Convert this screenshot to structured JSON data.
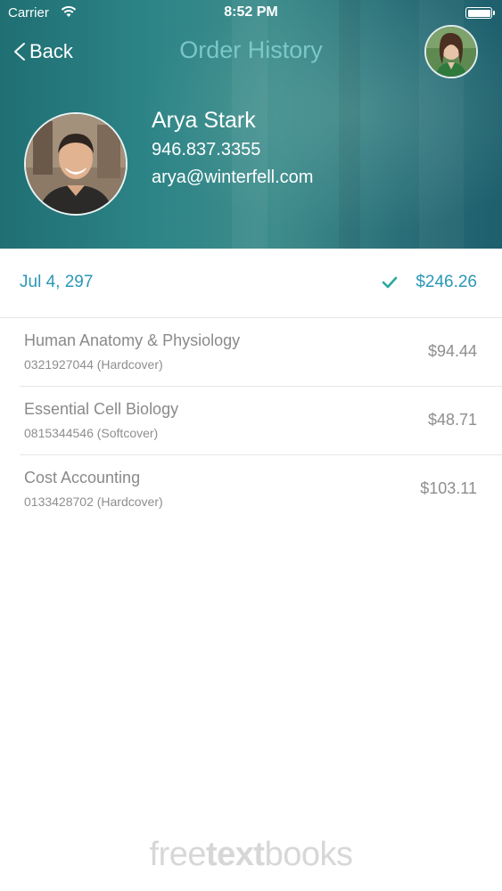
{
  "status_bar": {
    "carrier": "Carrier",
    "time": "8:52 PM",
    "wifi_icon": "wifi-icon",
    "battery_icon": "battery-icon"
  },
  "nav": {
    "back_label": "Back",
    "back_icon": "chevron-left-icon",
    "title": "Order History",
    "avatar": "user-avatar"
  },
  "profile": {
    "name": "Arya Stark",
    "phone": "946.837.3355",
    "email": "arya@winterfell.com"
  },
  "order": {
    "date": "Jul 4, 297",
    "status_icon": "checkmark-icon",
    "total": "$246.26"
  },
  "items": [
    {
      "title": "Human Anatomy & Physiology",
      "subtitle": "0321927044 (Hardcover)",
      "price": "$94.44"
    },
    {
      "title": "Essential Cell Biology",
      "subtitle": "0815344546 (Softcover)",
      "price": "$48.71"
    },
    {
      "title": "Cost Accounting",
      "subtitle": "0133428702 (Hardcover)",
      "price": "$103.11"
    }
  ],
  "watermark": {
    "part1": "free",
    "part2": "text",
    "part3": "books"
  },
  "colors": {
    "accent": "#2b97b5",
    "header_teal": "#2d8486",
    "text_gray": "#8a8a8a",
    "divider": "#e6e6e6"
  }
}
